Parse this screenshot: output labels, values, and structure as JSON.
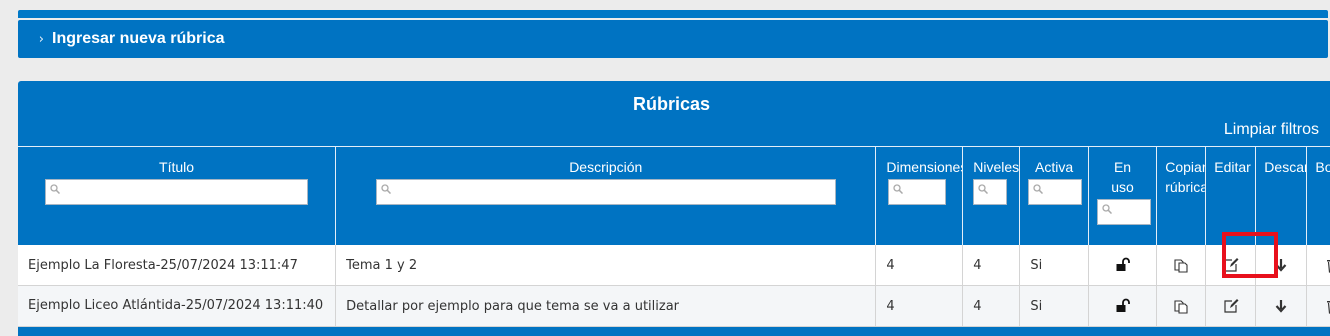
{
  "new_rubric": {
    "chevron": "›",
    "label": "Ingresar nueva rúbrica"
  },
  "panel": {
    "title": "Rúbricas",
    "clear_filters": "Limpiar filtros"
  },
  "columns": [
    {
      "key": "titulo",
      "label": "Título"
    },
    {
      "key": "descripcion",
      "label": "Descripción"
    },
    {
      "key": "dimensiones",
      "label": "Dimensiones"
    },
    {
      "key": "niveles",
      "label": "Niveles"
    },
    {
      "key": "activa",
      "label": "Activa"
    },
    {
      "key": "en_uso",
      "label": "En uso"
    },
    {
      "key": "copiar",
      "label": "Copiar rúbrica"
    },
    {
      "key": "editar",
      "label": "Editar"
    },
    {
      "key": "descargar",
      "label": "Descargar"
    },
    {
      "key": "borrar",
      "label": "Borrar"
    }
  ],
  "rows": [
    {
      "titulo": "Ejemplo La Floresta-25/07/2024 13:11:47",
      "descripcion": "Tema 1 y 2",
      "dimensiones": "4",
      "niveles": "4",
      "activa": "Si",
      "en_uso_icon": "unlock-icon",
      "copy_icon": "copy-icon",
      "edit_icon": "edit-icon",
      "download_icon": "download-arrow-icon",
      "delete_icon": "trash-icon"
    },
    {
      "titulo": "Ejemplo Liceo Atlántida-25/07/2024 13:11:40",
      "descripcion": "Detallar por ejemplo para que tema se va a utilizar",
      "dimensiones": "4",
      "niveles": "4",
      "activa": "Si",
      "en_uso_icon": "unlock-icon",
      "copy_icon": "copy-icon",
      "edit_icon": "edit-icon",
      "download_icon": "download-arrow-icon",
      "delete_icon": "trash-icon"
    }
  ],
  "colors": {
    "primary": "#0073c2",
    "highlight": "#e8101c",
    "background": "#ececec"
  }
}
